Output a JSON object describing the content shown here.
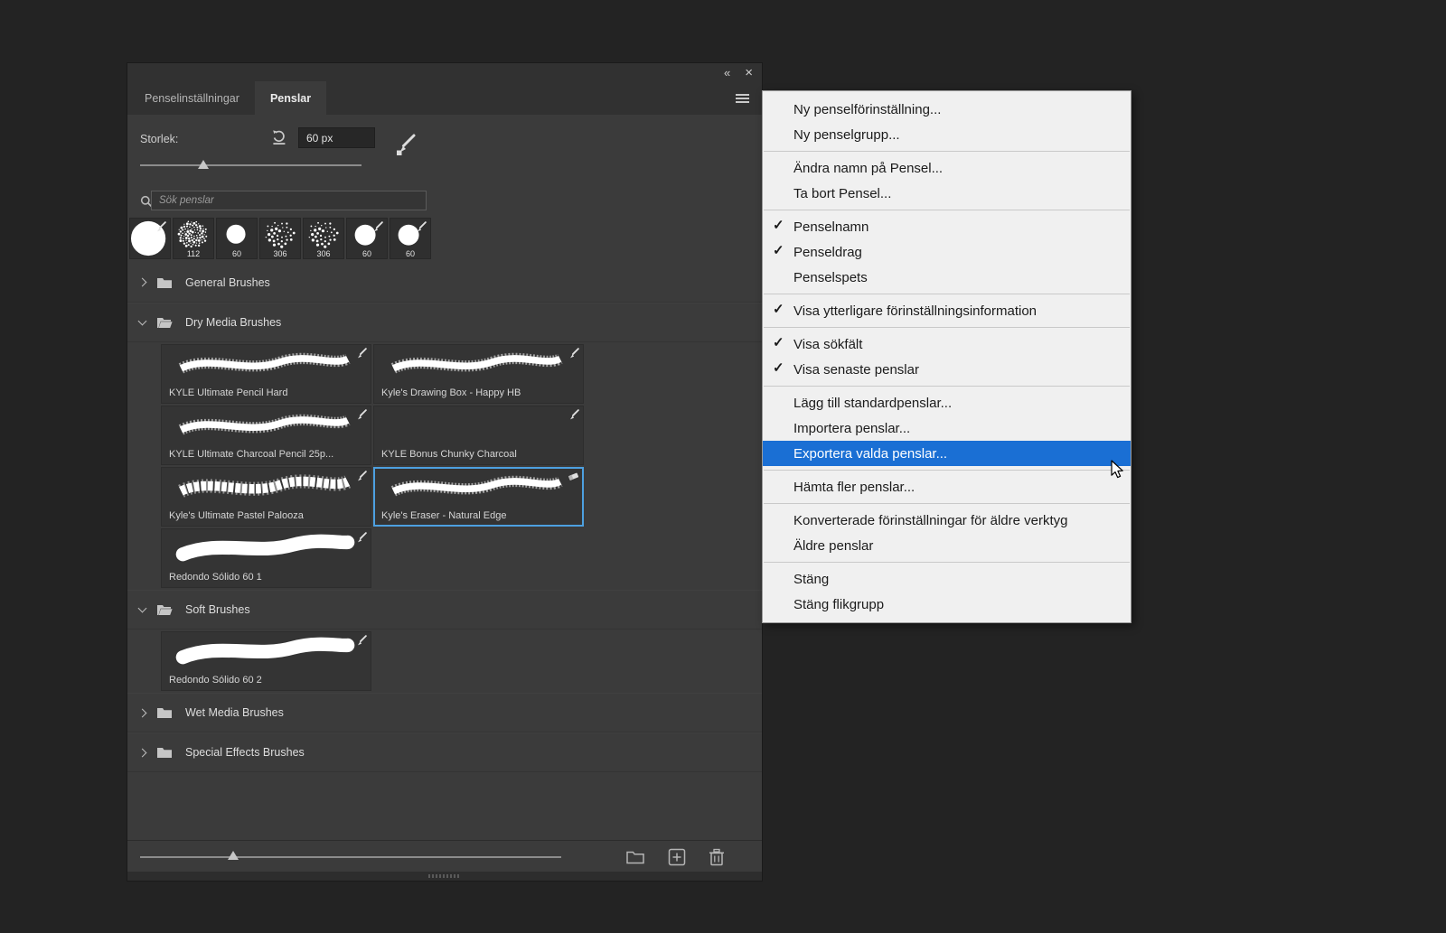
{
  "colors": {
    "panel_bg": "#3b3b3b",
    "selection_blue": "#4da0e0",
    "menu_highlight": "#1a6fd4"
  },
  "panel": {
    "header": {
      "collapse": "«",
      "close": "×"
    },
    "tabs": [
      {
        "label": "Penselinställningar",
        "active": false
      },
      {
        "label": "Penslar",
        "active": true
      }
    ],
    "size": {
      "label": "Storlek:",
      "value": "60 px"
    },
    "search": {
      "placeholder": "Sök penslar"
    },
    "recent": [
      {
        "label": "",
        "style": "big-circle"
      },
      {
        "label": "112",
        "style": "speckle"
      },
      {
        "label": "60",
        "style": "circle"
      },
      {
        "label": "306",
        "style": "scatter"
      },
      {
        "label": "306",
        "style": "scatter"
      },
      {
        "label": "60",
        "style": "circle-brush"
      },
      {
        "label": "60",
        "style": "circle-brush"
      }
    ],
    "groups": [
      {
        "name": "General Brushes",
        "expanded": false,
        "brushes": []
      },
      {
        "name": "Dry Media Brushes",
        "expanded": true,
        "brushes": [
          {
            "name": "KYLE Ultimate Pencil Hard",
            "icon": "brush",
            "stroke": "rough"
          },
          {
            "name": "Kyle's Drawing Box - Happy HB",
            "icon": "brush",
            "stroke": "rough"
          },
          {
            "name": "KYLE Ultimate Charcoal Pencil 25p...",
            "icon": "brush",
            "stroke": "rough"
          },
          {
            "name": "KYLE Bonus Chunky Charcoal",
            "icon": "brush",
            "stroke": "none"
          },
          {
            "name": "Kyle's Ultimate Pastel Palooza",
            "icon": "brush",
            "stroke": "chalk"
          },
          {
            "name": "Kyle's Eraser - Natural Edge",
            "icon": "eraser",
            "stroke": "rough",
            "selected": true
          },
          {
            "name": "Redondo Sólido 60 1",
            "icon": "brush",
            "stroke": "smooth"
          }
        ]
      },
      {
        "name": "Soft Brushes",
        "expanded": true,
        "brushes": [
          {
            "name": "Redondo Sólido 60 2",
            "icon": "brush",
            "stroke": "smooth"
          }
        ]
      },
      {
        "name": "Wet Media Brushes",
        "expanded": false,
        "brushes": []
      },
      {
        "name": "Special Effects Brushes",
        "expanded": false,
        "brushes": []
      }
    ],
    "footer_buttons": [
      "new-group-folder",
      "new-brush",
      "delete-brush"
    ]
  },
  "context_menu": {
    "check_glyph": "✓",
    "items": [
      {
        "type": "item",
        "label": "Ny penselförinställning..."
      },
      {
        "type": "item",
        "label": "Ny penselgrupp..."
      },
      {
        "type": "separator"
      },
      {
        "type": "item",
        "label": "Ändra namn på Pensel..."
      },
      {
        "type": "item",
        "label": "Ta bort Pensel..."
      },
      {
        "type": "separator"
      },
      {
        "type": "item",
        "label": "Penselnamn",
        "checked": true
      },
      {
        "type": "item",
        "label": "Penseldrag",
        "checked": true
      },
      {
        "type": "item",
        "label": "Penselspets"
      },
      {
        "type": "separator"
      },
      {
        "type": "item",
        "label": "Visa ytterligare förinställningsinformation",
        "checked": true
      },
      {
        "type": "separator"
      },
      {
        "type": "item",
        "label": "Visa sökfält",
        "checked": true
      },
      {
        "type": "item",
        "label": "Visa senaste penslar",
        "checked": true
      },
      {
        "type": "separator"
      },
      {
        "type": "item",
        "label": "Lägg till standardpenslar..."
      },
      {
        "type": "item",
        "label": "Importera penslar..."
      },
      {
        "type": "item",
        "label": "Exportera valda penslar...",
        "highlighted": true
      },
      {
        "type": "separator"
      },
      {
        "type": "item",
        "label": "Hämta fler penslar..."
      },
      {
        "type": "separator"
      },
      {
        "type": "item",
        "label": "Konverterade förinställningar för äldre verktyg"
      },
      {
        "type": "item",
        "label": "Äldre penslar"
      },
      {
        "type": "separator"
      },
      {
        "type": "item",
        "label": "Stäng"
      },
      {
        "type": "item",
        "label": "Stäng flikgrupp"
      }
    ]
  }
}
